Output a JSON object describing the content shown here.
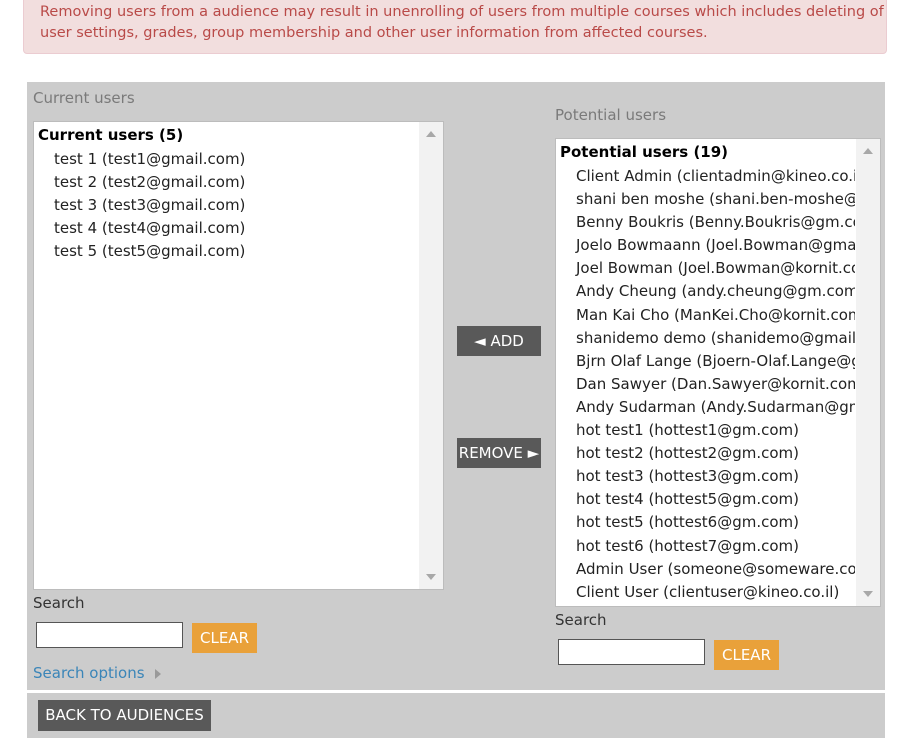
{
  "alert": {
    "line1": "Removing users from a audience may result in unenrolling of users from multiple courses which includes deleting of",
    "line2": "user settings, grades, group membership and other user information from affected courses."
  },
  "current": {
    "heading": "Current users",
    "group_label": "Current users (5)",
    "users": [
      "test 1 (test1@gmail.com)",
      "test 2 (test2@gmail.com)",
      "test 3 (test3@gmail.com)",
      "test 4 (test4@gmail.com)",
      "test 5 (test5@gmail.com)"
    ],
    "search_label": "Search",
    "search_value": "",
    "clear_label": "CLEAR",
    "search_options_label": "Search options"
  },
  "actions": {
    "add_label": "◄ ADD",
    "remove_label": "REMOVE ►"
  },
  "potential": {
    "heading": "Potential users",
    "group_label": "Potential users (19)",
    "users": [
      "Client Admin (clientadmin@kineo.co.il)",
      "shani ben moshe (shani.ben-moshe@kornit.com)",
      "Benny Boukris (Benny.Boukris@gm.com)",
      "Joelo Bowmaann (Joel.Bowman@gmail.com)",
      "Joel Bowman (Joel.Bowman@kornit.com)",
      "Andy Cheung (andy.cheung@gm.com)",
      "Man Kai Cho (ManKei.Cho@kornit.com)",
      "shanidemo demo (shanidemo@gmail.com)",
      "Bjrn Olaf Lange (Bjoern-Olaf.Lange@gm.com)",
      "Dan Sawyer (Dan.Sawyer@kornit.com)",
      "Andy Sudarman (Andy.Sudarman@gm.com)",
      "hot test1 (hottest1@gm.com)",
      "hot test2 (hottest2@gm.com)",
      "hot test3 (hottest3@gm.com)",
      "hot test4 (hottest5@gm.com)",
      "hot test5 (hottest6@gm.com)",
      "hot test6 (hottest7@gm.com)",
      "Admin User (someone@someware.com)",
      "Client User (clientuser@kineo.co.il)"
    ],
    "search_label": "Search",
    "search_value": "",
    "clear_label": "CLEAR"
  },
  "footer": {
    "back_label": "BACK TO AUDIENCES"
  }
}
